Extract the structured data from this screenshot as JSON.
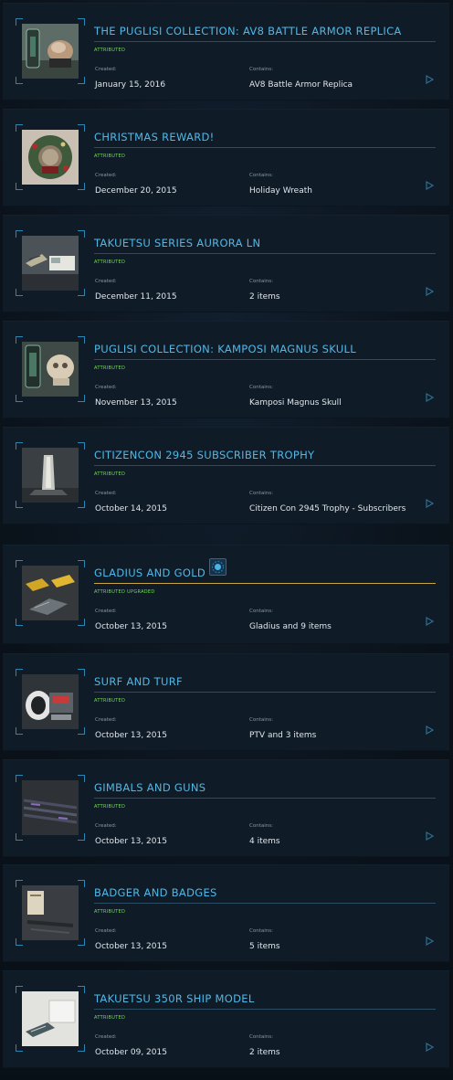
{
  "labels": {
    "created": "Created:",
    "contains": "Contains:"
  },
  "colors": {
    "title": "#4fb8e8",
    "status": "#6ae04a",
    "gold_rule": "#c7a444",
    "frame": "#2a86b4"
  },
  "items": [
    {
      "title": "THE PUGLISI COLLECTION: AV8 BATTLE ARMOR REPLICA",
      "status": "ATTRIBUTED",
      "created": "January 15, 2016",
      "contains": "AV8 Battle Armor Replica",
      "thumb": "armor-replica-thumbnail"
    },
    {
      "title": "CHRISTMAS REWARD!",
      "status": "ATTRIBUTED",
      "created": "December 20, 2015",
      "contains": "Holiday Wreath",
      "thumb": "holiday-wreath-thumbnail"
    },
    {
      "title": "TAKUETSU SERIES AURORA LN",
      "status": "ATTRIBUTED",
      "created": "December 11, 2015",
      "contains": "2 items",
      "thumb": "aurora-model-thumbnail"
    },
    {
      "title": "PUGLISI COLLECTION: KAMPOSI MAGNUS SKULL",
      "status": "ATTRIBUTED",
      "created": "November 13, 2015",
      "contains": "Kamposi Magnus Skull",
      "thumb": "skull-thumbnail"
    },
    {
      "title": "CITIZENCON 2945 SUBSCRIBER TROPHY",
      "status": "ATTRIBUTED",
      "created": "October 14, 2015",
      "contains": "Citizen Con 2945 Trophy - Subscribers",
      "thumb": "trophy-thumbnail"
    },
    {
      "title": "GLADIUS AND GOLD",
      "status": "ATTRIBUTED UPGRADED",
      "created": "October 13, 2015",
      "contains": "Gladius and 9 items",
      "thumb": "gladius-thumbnail",
      "badge": "upgrade-badge-icon"
    },
    {
      "title": "SURF AND TURF",
      "status": "ATTRIBUTED",
      "created": "October 13, 2015",
      "contains": "PTV and 3 items",
      "thumb": "ptv-thumbnail"
    },
    {
      "title": "GIMBALS AND GUNS",
      "status": "ATTRIBUTED",
      "created": "October 13, 2015",
      "contains": "4 items",
      "thumb": "guns-thumbnail"
    },
    {
      "title": "BADGER AND BADGES",
      "status": "ATTRIBUTED",
      "created": "October 13, 2015",
      "contains": "5 items",
      "thumb": "badger-thumbnail"
    },
    {
      "title": "TAKUETSU 350R SHIP MODEL",
      "status": "ATTRIBUTED",
      "created": "October 09, 2015",
      "contains": "2 items",
      "thumb": "ship-model-thumbnail"
    }
  ]
}
